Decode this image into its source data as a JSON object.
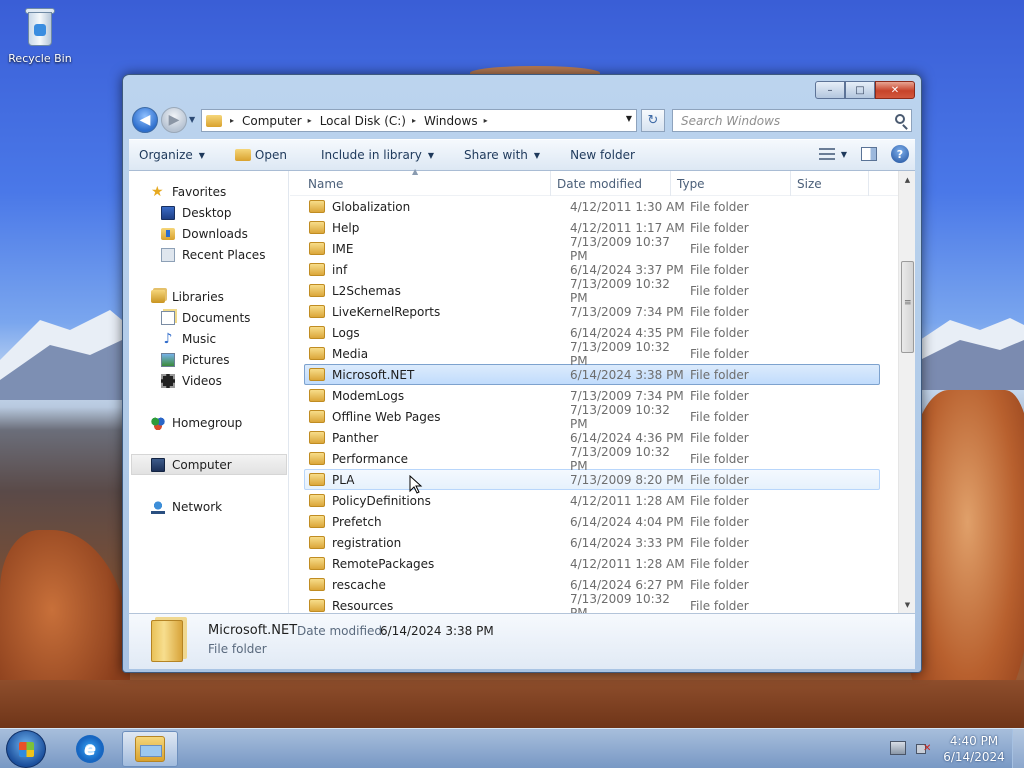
{
  "desktop": {
    "recycle_bin_label": "Recycle Bin"
  },
  "window": {
    "caption_buttons": {
      "minimize": "–",
      "maximize": "□",
      "close": "✕"
    },
    "address": {
      "crumbs": [
        "Computer",
        "Local Disk (C:)",
        "Windows"
      ],
      "separator": "▸",
      "dropdown": "▼",
      "refresh": "↻"
    },
    "search": {
      "placeholder": "Search Windows"
    },
    "toolbar": {
      "organize": "Organize",
      "open": "Open",
      "include_in_library": "Include in library",
      "share_with": "Share with",
      "new_folder": "New folder",
      "arrow": "▼",
      "help": "?"
    },
    "nav": {
      "favorites": "Favorites",
      "desktop": "Desktop",
      "downloads": "Downloads",
      "recent_places": "Recent Places",
      "libraries": "Libraries",
      "documents": "Documents",
      "music": "Music",
      "pictures": "Pictures",
      "videos": "Videos",
      "homegroup": "Homegroup",
      "computer": "Computer",
      "network": "Network"
    },
    "columns": {
      "name": "Name",
      "date_modified": "Date modified",
      "type": "Type",
      "size": "Size",
      "sort_indicator": "▲"
    },
    "files": [
      {
        "name": "Globalization",
        "date": "4/12/2011 1:30 AM",
        "type": "File folder"
      },
      {
        "name": "Help",
        "date": "4/12/2011 1:17 AM",
        "type": "File folder"
      },
      {
        "name": "IME",
        "date": "7/13/2009 10:37 PM",
        "type": "File folder"
      },
      {
        "name": "inf",
        "date": "6/14/2024 3:37 PM",
        "type": "File folder"
      },
      {
        "name": "L2Schemas",
        "date": "7/13/2009 10:32 PM",
        "type": "File folder"
      },
      {
        "name": "LiveKernelReports",
        "date": "7/13/2009 7:34 PM",
        "type": "File folder"
      },
      {
        "name": "Logs",
        "date": "6/14/2024 4:35 PM",
        "type": "File folder"
      },
      {
        "name": "Media",
        "date": "7/13/2009 10:32 PM",
        "type": "File folder"
      },
      {
        "name": "Microsoft.NET",
        "date": "6/14/2024 3:38 PM",
        "type": "File folder"
      },
      {
        "name": "ModemLogs",
        "date": "7/13/2009 7:34 PM",
        "type": "File folder"
      },
      {
        "name": "Offline Web Pages",
        "date": "7/13/2009 10:32 PM",
        "type": "File folder"
      },
      {
        "name": "Panther",
        "date": "6/14/2024 4:36 PM",
        "type": "File folder"
      },
      {
        "name": "Performance",
        "date": "7/13/2009 10:32 PM",
        "type": "File folder"
      },
      {
        "name": "PLA",
        "date": "7/13/2009 8:20 PM",
        "type": "File folder"
      },
      {
        "name": "PolicyDefinitions",
        "date": "4/12/2011 1:28 AM",
        "type": "File folder"
      },
      {
        "name": "Prefetch",
        "date": "6/14/2024 4:04 PM",
        "type": "File folder"
      },
      {
        "name": "registration",
        "date": "6/14/2024 3:33 PM",
        "type": "File folder"
      },
      {
        "name": "RemotePackages",
        "date": "4/12/2011 1:28 AM",
        "type": "File folder"
      },
      {
        "name": "rescache",
        "date": "6/14/2024 6:27 PM",
        "type": "File folder"
      },
      {
        "name": "Resources",
        "date": "7/13/2009 10:32 PM",
        "type": "File folder"
      }
    ],
    "selected_index": 8,
    "hover_index": 13,
    "scrollbar": {
      "up": "▲",
      "down": "▼"
    },
    "details": {
      "name": "Microsoft.NET",
      "date_label": "Date modified:",
      "date_value": "6/14/2024 3:38 PM",
      "type": "File folder"
    }
  },
  "taskbar": {
    "time": "4:40 PM",
    "date": "6/14/2024",
    "ie_glyph": "e"
  }
}
